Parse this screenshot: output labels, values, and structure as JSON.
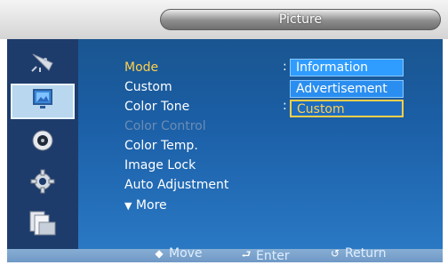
{
  "window": {
    "title": "Picture"
  },
  "sidebar": {
    "items": [
      {
        "icon": "satellite-dish-icon"
      },
      {
        "icon": "picture-icon",
        "active": true
      },
      {
        "icon": "sound-icon"
      },
      {
        "icon": "gear-icon"
      },
      {
        "icon": "multi-window-icon"
      }
    ]
  },
  "menu": {
    "items": [
      {
        "label": "Mode",
        "state": "selected"
      },
      {
        "label": "Custom",
        "state": "normal"
      },
      {
        "label": "Color Tone",
        "state": "normal"
      },
      {
        "label": "Color Control",
        "state": "disabled"
      },
      {
        "label": "Color Temp.",
        "state": "normal"
      },
      {
        "label": "Image Lock",
        "state": "normal"
      },
      {
        "label": "Auto Adjustment",
        "state": "normal"
      },
      {
        "label": "More",
        "state": "normal",
        "icon": "down-triangle-icon"
      }
    ],
    "colon": ":"
  },
  "mode_dropdown": {
    "options": [
      "Information",
      "Advertisement",
      "Custom"
    ],
    "selected": "Custom"
  },
  "footer": {
    "move_label": "Move",
    "enter_label": "Enter",
    "return_label": "Return"
  },
  "colors": {
    "accent": "#ffd04a",
    "panel": "#1b5fa6",
    "sidebar": "#1d3c6c"
  }
}
